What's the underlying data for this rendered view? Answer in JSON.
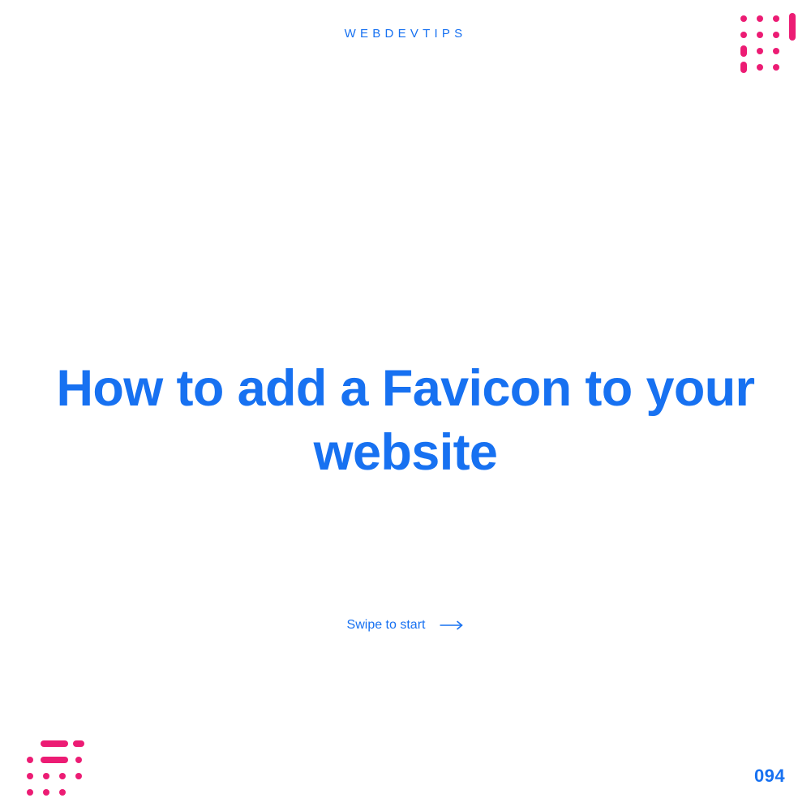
{
  "brand": "WEBDEVTIPS",
  "title": "How to add a Favicon to your website",
  "swipe_text": "Swipe to start",
  "page_number": "094",
  "colors": {
    "primary": "#1771F1",
    "accent": "#EC1C74"
  },
  "icons": {
    "arrow": "arrow-right-icon",
    "logo": "dot-pattern-logo-icon"
  }
}
